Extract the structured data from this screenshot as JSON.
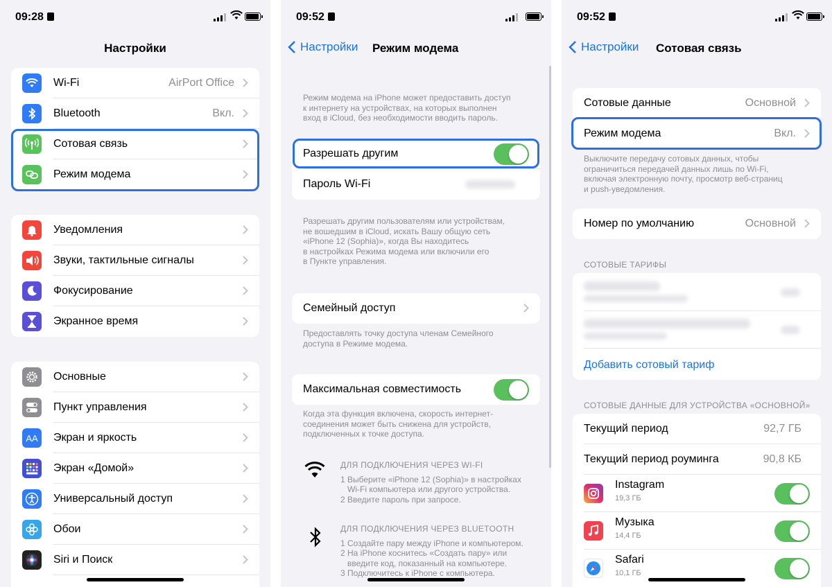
{
  "screen1": {
    "status": {
      "time": "09:28"
    },
    "title": "Настройки",
    "group1": [
      {
        "label": "Wi-Fi",
        "value": "AirPort Office",
        "icon": "wifi-icon",
        "color": "#2f7cf6"
      },
      {
        "label": "Bluetooth",
        "value": "Вкл.",
        "icon": "bluetooth-icon",
        "color": "#2f7cf6"
      },
      {
        "label": "Сотовая связь",
        "value": "",
        "icon": "antenna-icon",
        "color": "#58c35a"
      },
      {
        "label": "Режим модема",
        "value": "",
        "icon": "hotspot-icon",
        "color": "#58c35a"
      }
    ],
    "group2": [
      {
        "label": "Уведомления",
        "icon": "bell-icon",
        "color": "#f2463b"
      },
      {
        "label": "Звуки, тактильные сигналы",
        "icon": "speaker-icon",
        "color": "#f2463b"
      },
      {
        "label": "Фокусирование",
        "icon": "moon-icon",
        "color": "#5a4fd6"
      },
      {
        "label": "Экранное время",
        "icon": "hourglass-icon",
        "color": "#5a4fd6"
      }
    ],
    "group3": [
      {
        "label": "Основные",
        "icon": "gear-icon",
        "color": "#8e8e93"
      },
      {
        "label": "Пункт управления",
        "icon": "toggles-icon",
        "color": "#8e8e93"
      },
      {
        "label": "Экран и яркость",
        "icon": "aa-icon",
        "color": "#2f7cf6",
        "glyph": "AA"
      },
      {
        "label": "Экран «Домой»",
        "icon": "grid-icon",
        "color": "#3f4fd6"
      },
      {
        "label": "Универсальный доступ",
        "icon": "accessibility-icon",
        "color": "#2f7cf6"
      },
      {
        "label": "Обои",
        "icon": "flower-icon",
        "color": "#37a6e8"
      },
      {
        "label": "Siri и Поиск",
        "icon": "siri-icon",
        "color": "#222222"
      }
    ]
  },
  "screen2": {
    "status": {
      "time": "09:52"
    },
    "back_label": "Настройки",
    "title": "Режим модема",
    "intro": "Режим модема на iPhone может предоставить доступ\nк интернету на устройствах, на которых выполнен\nвход в iCloud, без необходимости вводить пароль.",
    "allow_label": "Разрешать другим",
    "wifi_password_label": "Пароль Wi-Fi",
    "allow_note": "Разрешать другим пользователям или устройствам,\nне вошедшим в iCloud, искать Вашу общую сеть\n«iPhone 12 (Sophia)», когда Вы находитесь\nв настройках Режима модема или включили его\nв Пункте управления.",
    "family_label": "Семейный доступ",
    "family_note": "Предоставлять точку доступа членам Семейного\nдоступа в Режиме модема.",
    "compat_label": "Максимальная совместимость",
    "compat_note": "Когда эта функция включена, скорость интернет-\nсоединения может быть снижена для устройств,\nподключенных к точке доступа.",
    "wifi_head": "ДЛЯ ПОДКЛЮЧЕНИЯ ЧЕРЕЗ WI-FI",
    "wifi_steps": "1 Выберите «iPhone 12 (Sophia)» в настройках\n   Wi-Fi компьютера или другого устройства.\n2 Введите пароль при запросе.",
    "bt_head": "ДЛЯ ПОДКЛЮЧЕНИЯ ЧЕРЕЗ BLUETOOTH",
    "bt_steps": "1 Создайте пару между iPhone и компьютером.\n2 На iPhone коснитесь «Создать пару» или\n   введите код, показанный на компьютере.\n3 Подключитесь к iPhone с компьютера."
  },
  "screen3": {
    "status": {
      "time": "09:52"
    },
    "back_label": "Настройки",
    "title": "Сотовая связь",
    "cellular_data_label": "Сотовые данные",
    "cellular_data_value": "Основной",
    "hotspot_label": "Режим модема",
    "hotspot_value": "Вкл.",
    "data_note": "Выключите передачу сотовых данных, чтобы\nограничиться передачей данных лишь по Wi-Fi,\nвключая электронную почту, просмотр веб-страниц\nи push-уведомления.",
    "default_label": "Номер по умолчанию",
    "default_value": "Основной",
    "plans_header": "СОТОВЫЕ ТАРИФЫ",
    "add_plan": "Добавить сотовый тариф",
    "device_header": "СОТОВЫЕ ДАННЫЕ ДЛЯ УСТРОЙСТВА «ОСНОВНОЙ»",
    "current_label": "Текущий период",
    "current_value": "92,7 ГБ",
    "roaming_label": "Текущий период роуминга",
    "roaming_value": "90,8 КБ",
    "apps": [
      {
        "name": "Instagram",
        "size": "19,3 ГБ",
        "icon": "instagram-icon"
      },
      {
        "name": "Музыка",
        "size": "14,4 ГБ",
        "icon": "music-icon"
      },
      {
        "name": "Safari",
        "size": "10,1 ГБ",
        "icon": "safari-icon"
      }
    ]
  },
  "colors": {
    "accent": "#1a73e8",
    "toggle_on": "#5ac05e",
    "highlight": "#2c6fe3"
  }
}
